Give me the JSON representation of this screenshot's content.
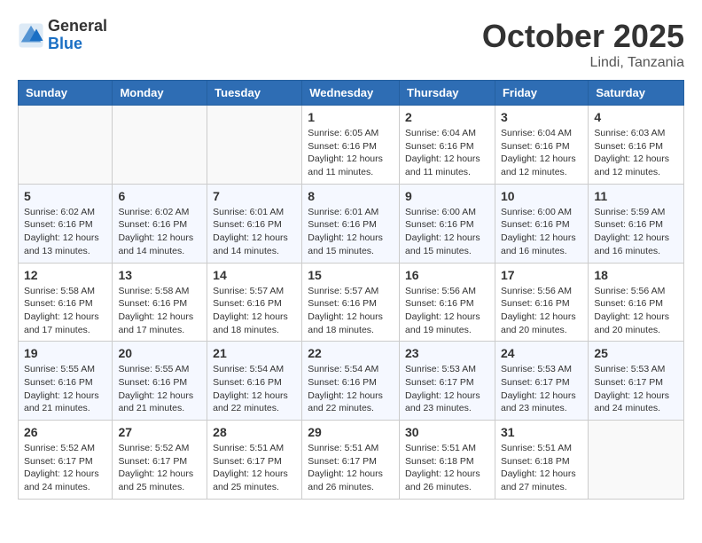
{
  "header": {
    "logo": {
      "general": "General",
      "blue": "Blue"
    },
    "month": "October 2025",
    "location": "Lindi, Tanzania"
  },
  "weekdays": [
    "Sunday",
    "Monday",
    "Tuesday",
    "Wednesday",
    "Thursday",
    "Friday",
    "Saturday"
  ],
  "weeks": [
    [
      {
        "day": "",
        "info": ""
      },
      {
        "day": "",
        "info": ""
      },
      {
        "day": "",
        "info": ""
      },
      {
        "day": "1",
        "info": "Sunrise: 6:05 AM\nSunset: 6:16 PM\nDaylight: 12 hours\nand 11 minutes."
      },
      {
        "day": "2",
        "info": "Sunrise: 6:04 AM\nSunset: 6:16 PM\nDaylight: 12 hours\nand 11 minutes."
      },
      {
        "day": "3",
        "info": "Sunrise: 6:04 AM\nSunset: 6:16 PM\nDaylight: 12 hours\nand 12 minutes."
      },
      {
        "day": "4",
        "info": "Sunrise: 6:03 AM\nSunset: 6:16 PM\nDaylight: 12 hours\nand 12 minutes."
      }
    ],
    [
      {
        "day": "5",
        "info": "Sunrise: 6:02 AM\nSunset: 6:16 PM\nDaylight: 12 hours\nand 13 minutes."
      },
      {
        "day": "6",
        "info": "Sunrise: 6:02 AM\nSunset: 6:16 PM\nDaylight: 12 hours\nand 14 minutes."
      },
      {
        "day": "7",
        "info": "Sunrise: 6:01 AM\nSunset: 6:16 PM\nDaylight: 12 hours\nand 14 minutes."
      },
      {
        "day": "8",
        "info": "Sunrise: 6:01 AM\nSunset: 6:16 PM\nDaylight: 12 hours\nand 15 minutes."
      },
      {
        "day": "9",
        "info": "Sunrise: 6:00 AM\nSunset: 6:16 PM\nDaylight: 12 hours\nand 15 minutes."
      },
      {
        "day": "10",
        "info": "Sunrise: 6:00 AM\nSunset: 6:16 PM\nDaylight: 12 hours\nand 16 minutes."
      },
      {
        "day": "11",
        "info": "Sunrise: 5:59 AM\nSunset: 6:16 PM\nDaylight: 12 hours\nand 16 minutes."
      }
    ],
    [
      {
        "day": "12",
        "info": "Sunrise: 5:58 AM\nSunset: 6:16 PM\nDaylight: 12 hours\nand 17 minutes."
      },
      {
        "day": "13",
        "info": "Sunrise: 5:58 AM\nSunset: 6:16 PM\nDaylight: 12 hours\nand 17 minutes."
      },
      {
        "day": "14",
        "info": "Sunrise: 5:57 AM\nSunset: 6:16 PM\nDaylight: 12 hours\nand 18 minutes."
      },
      {
        "day": "15",
        "info": "Sunrise: 5:57 AM\nSunset: 6:16 PM\nDaylight: 12 hours\nand 18 minutes."
      },
      {
        "day": "16",
        "info": "Sunrise: 5:56 AM\nSunset: 6:16 PM\nDaylight: 12 hours\nand 19 minutes."
      },
      {
        "day": "17",
        "info": "Sunrise: 5:56 AM\nSunset: 6:16 PM\nDaylight: 12 hours\nand 20 minutes."
      },
      {
        "day": "18",
        "info": "Sunrise: 5:56 AM\nSunset: 6:16 PM\nDaylight: 12 hours\nand 20 minutes."
      }
    ],
    [
      {
        "day": "19",
        "info": "Sunrise: 5:55 AM\nSunset: 6:16 PM\nDaylight: 12 hours\nand 21 minutes."
      },
      {
        "day": "20",
        "info": "Sunrise: 5:55 AM\nSunset: 6:16 PM\nDaylight: 12 hours\nand 21 minutes."
      },
      {
        "day": "21",
        "info": "Sunrise: 5:54 AM\nSunset: 6:16 PM\nDaylight: 12 hours\nand 22 minutes."
      },
      {
        "day": "22",
        "info": "Sunrise: 5:54 AM\nSunset: 6:16 PM\nDaylight: 12 hours\nand 22 minutes."
      },
      {
        "day": "23",
        "info": "Sunrise: 5:53 AM\nSunset: 6:17 PM\nDaylight: 12 hours\nand 23 minutes."
      },
      {
        "day": "24",
        "info": "Sunrise: 5:53 AM\nSunset: 6:17 PM\nDaylight: 12 hours\nand 23 minutes."
      },
      {
        "day": "25",
        "info": "Sunrise: 5:53 AM\nSunset: 6:17 PM\nDaylight: 12 hours\nand 24 minutes."
      }
    ],
    [
      {
        "day": "26",
        "info": "Sunrise: 5:52 AM\nSunset: 6:17 PM\nDaylight: 12 hours\nand 24 minutes."
      },
      {
        "day": "27",
        "info": "Sunrise: 5:52 AM\nSunset: 6:17 PM\nDaylight: 12 hours\nand 25 minutes."
      },
      {
        "day": "28",
        "info": "Sunrise: 5:51 AM\nSunset: 6:17 PM\nDaylight: 12 hours\nand 25 minutes."
      },
      {
        "day": "29",
        "info": "Sunrise: 5:51 AM\nSunset: 6:17 PM\nDaylight: 12 hours\nand 26 minutes."
      },
      {
        "day": "30",
        "info": "Sunrise: 5:51 AM\nSunset: 6:18 PM\nDaylight: 12 hours\nand 26 minutes."
      },
      {
        "day": "31",
        "info": "Sunrise: 5:51 AM\nSunset: 6:18 PM\nDaylight: 12 hours\nand 27 minutes."
      },
      {
        "day": "",
        "info": ""
      }
    ]
  ]
}
